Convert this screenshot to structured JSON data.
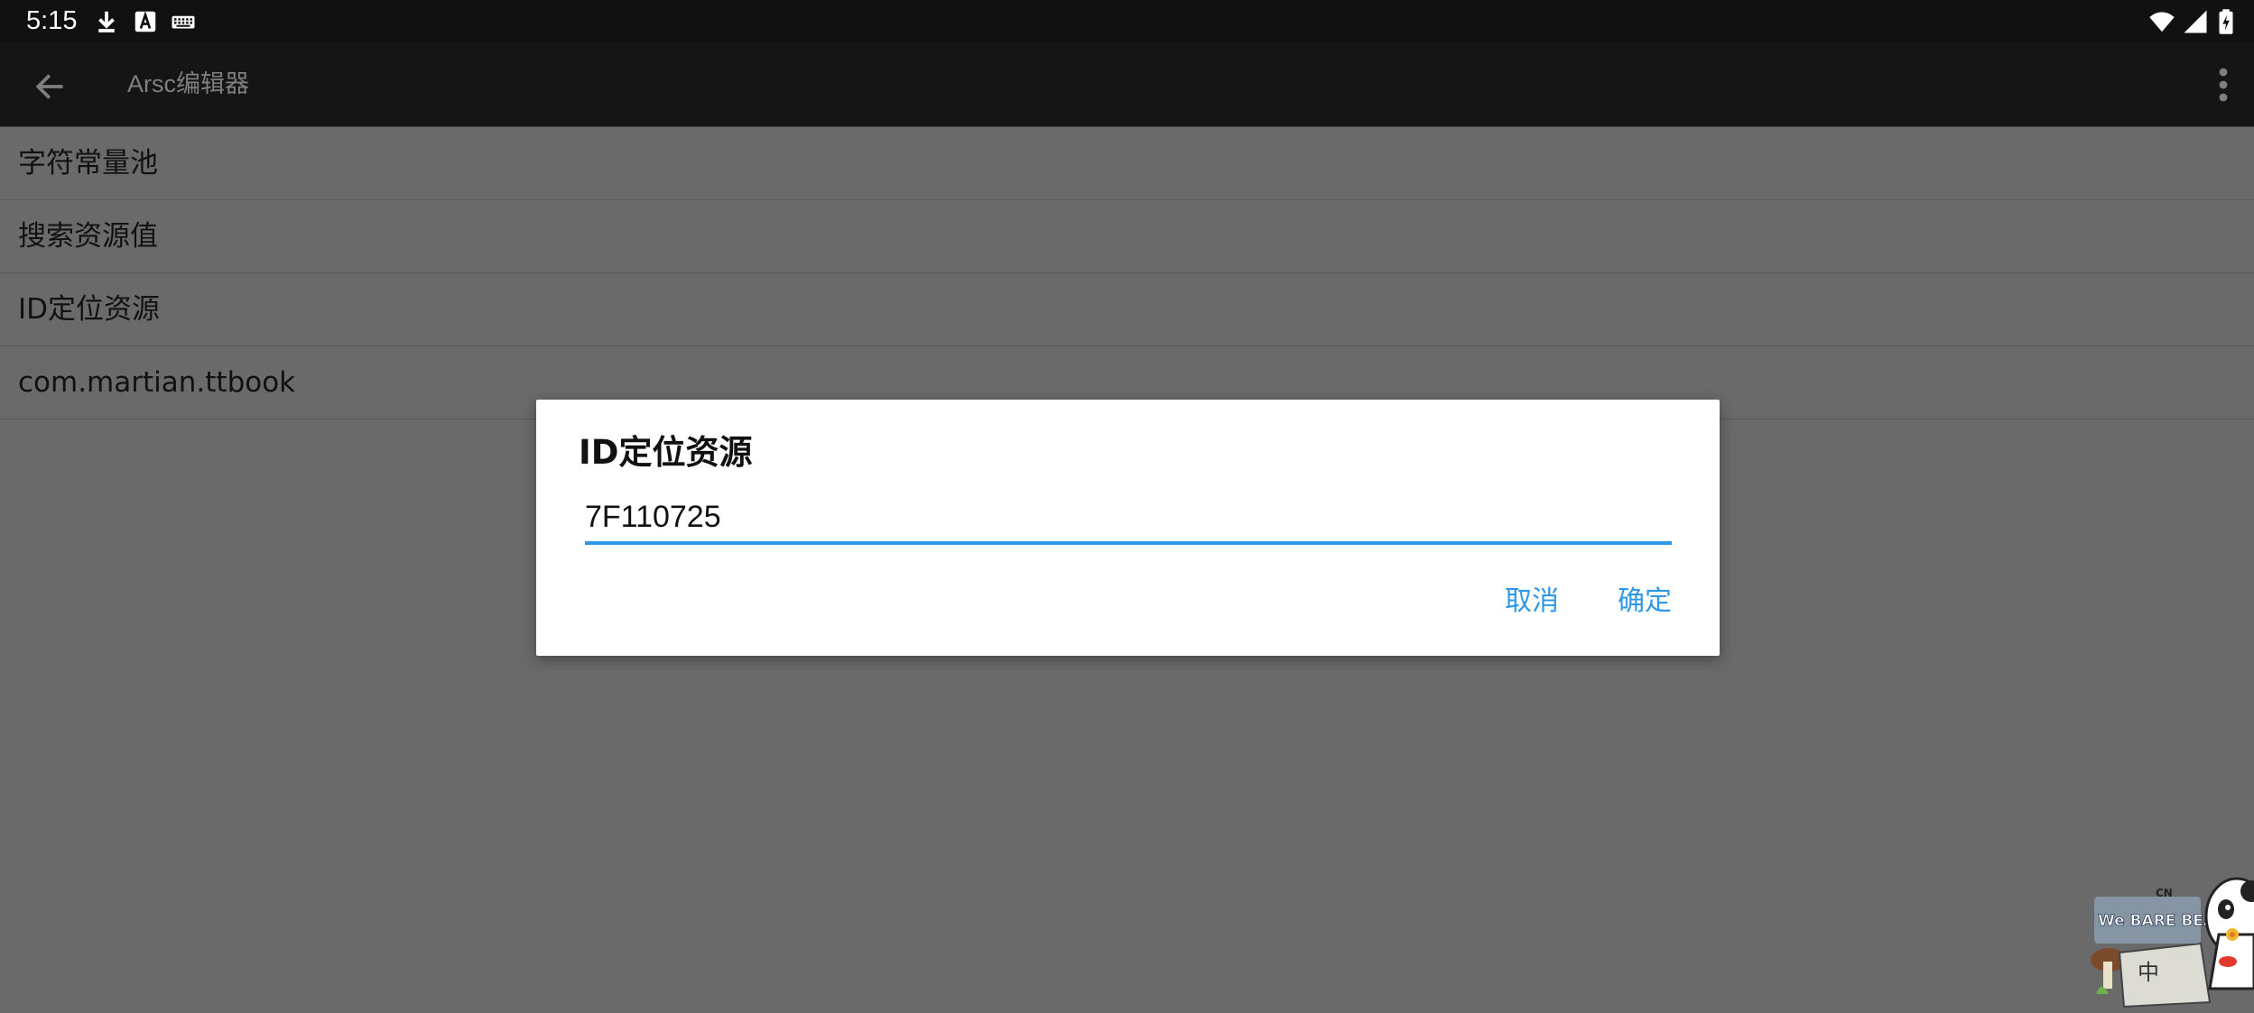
{
  "status_bar": {
    "time": "5:15",
    "icons": [
      "download-icon",
      "font-icon",
      "keyboard-icon",
      "wifi-icon",
      "signal-icon",
      "battery-icon"
    ]
  },
  "app_bar": {
    "title": "Arsc编辑器",
    "back_icon": "arrow-left-icon",
    "overflow_icon": "more-vertical-icon"
  },
  "list": {
    "items": [
      {
        "label": "字符常量池"
      },
      {
        "label": "搜索资源值"
      },
      {
        "label": "ID定位资源"
      },
      {
        "label": "com.martian.ttbook"
      }
    ]
  },
  "dialog": {
    "title": "ID定位资源",
    "input_value": "7F110725",
    "cancel_label": "取消",
    "ok_label": "确定"
  },
  "sticker": {
    "brand_text": "We BARE BEARS",
    "network_text": "CN",
    "chinese_text": "中"
  },
  "colors": {
    "accent": "#2f98e6",
    "app_bar": "#151515",
    "status_bar": "#111111",
    "scrim_background": "#6a6a6a",
    "dialog_background": "#ffffff"
  }
}
